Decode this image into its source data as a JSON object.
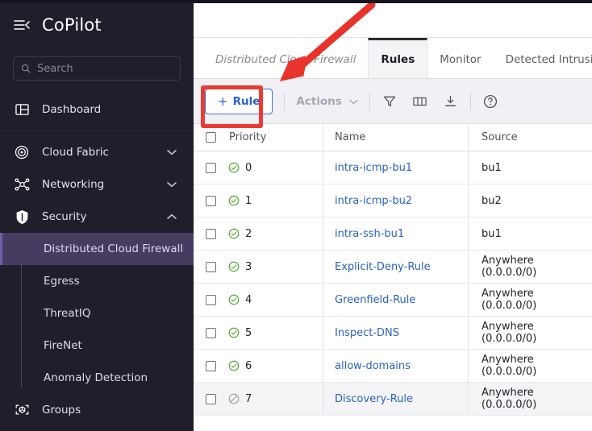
{
  "sidebar": {
    "brand": "CoPilot",
    "menu_icon": "collapse-menu-icon",
    "search": {
      "placeholder": "Search",
      "value": "",
      "icon": "search-icon"
    },
    "items": [
      {
        "label": "Dashboard",
        "icon": "dashboard-icon",
        "expandable": false
      },
      {
        "label": "Cloud Fabric",
        "icon": "cloud-fabric-icon",
        "expandable": true,
        "expanded": false
      },
      {
        "label": "Networking",
        "icon": "networking-icon",
        "expandable": true,
        "expanded": false
      },
      {
        "label": "Security",
        "icon": "shield-icon",
        "expandable": true,
        "expanded": true
      },
      {
        "label": "Groups",
        "icon": "groups-cube-icon",
        "expandable": false
      }
    ],
    "security_children": [
      {
        "label": "Distributed Cloud Firewall",
        "active": true
      },
      {
        "label": "Egress",
        "active": false
      },
      {
        "label": "ThreatIQ",
        "active": false
      },
      {
        "label": "FireNet",
        "active": false
      },
      {
        "label": "Anomaly Detection",
        "active": false
      }
    ]
  },
  "main": {
    "tabs": [
      {
        "label": "Distributed Cloud Firewall",
        "type": "breadcrumb",
        "active": false
      },
      {
        "label": "Rules",
        "type": "tab",
        "active": true
      },
      {
        "label": "Monitor",
        "type": "tab",
        "active": false
      },
      {
        "label": "Detected Intrusions",
        "type": "tab",
        "active": false
      }
    ],
    "toolbar": {
      "add_rule_label": "Rule",
      "add_rule_plus": "+",
      "actions_label": "Actions",
      "actions_disabled": true,
      "actions_chevron": "chevron-down-icon",
      "icons": [
        {
          "name": "filter-icon"
        },
        {
          "name": "columns-icon"
        },
        {
          "name": "download-icon"
        },
        {
          "name": "help-icon"
        }
      ]
    },
    "table": {
      "columns": [
        "Priority",
        "Name",
        "Source"
      ],
      "rows": [
        {
          "priority": "0",
          "status": "enabled",
          "name": "intra-icmp-bu1",
          "source": "bu1",
          "shaded": false
        },
        {
          "priority": "1",
          "status": "enabled",
          "name": "intra-icmp-bu2",
          "source": "bu2",
          "shaded": false
        },
        {
          "priority": "2",
          "status": "enabled",
          "name": "intra-ssh-bu1",
          "source": "bu1",
          "shaded": false
        },
        {
          "priority": "3",
          "status": "enabled",
          "name": "Explicit-Deny-Rule",
          "source": "Anywhere (0.0.0.0/0)",
          "shaded": false
        },
        {
          "priority": "4",
          "status": "enabled",
          "name": "Greenfield-Rule",
          "source": "Anywhere (0.0.0.0/0)",
          "shaded": false
        },
        {
          "priority": "5",
          "status": "enabled",
          "name": "Inspect-DNS",
          "source": "Anywhere (0.0.0.0/0)",
          "shaded": false
        },
        {
          "priority": "6",
          "status": "enabled",
          "name": "allow-domains",
          "source": "Anywhere (0.0.0.0/0)",
          "shaded": false
        },
        {
          "priority": "7",
          "status": "disabled",
          "name": "Discovery-Rule",
          "source": "Anywhere (0.0.0.0/0)",
          "shaded": true
        }
      ]
    }
  },
  "annotations": {
    "arrow_color": "#e8332c",
    "highlight_color": "#ea3a33",
    "highlight_target": "add-rule-button"
  },
  "colors": {
    "sidebar_bg": "#201e2b",
    "sidebar_active": "#453c60",
    "accent_blue": "#2b63c4",
    "status_enabled": "#5aa83a",
    "status_disabled": "#a3a3ad",
    "toolbar_bg": "#f1f1f5"
  }
}
